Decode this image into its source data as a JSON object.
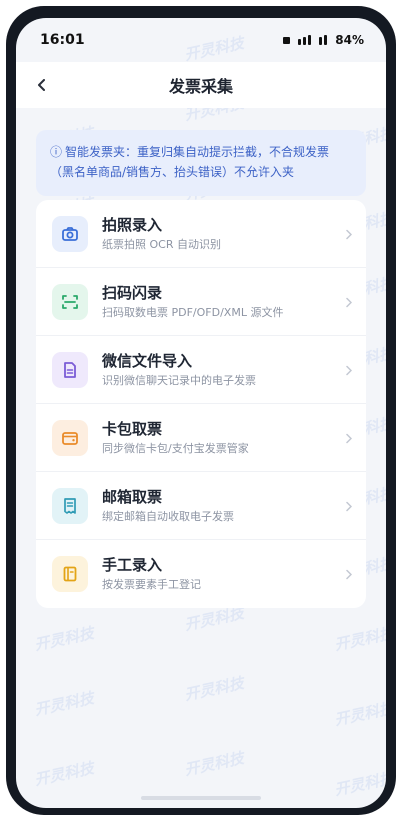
{
  "status_bar": {
    "time": "16:01",
    "battery": "84%"
  },
  "nav": {
    "title": "发票采集",
    "back_icon": "chevron-left-icon"
  },
  "notice": {
    "icon": "info-icon",
    "icon_glyph": "ⓘ",
    "text": "智能发票夹：重复归集自动提示拦截，不合规发票（黑名单商品/销售方、抬头错误）不允许入夹"
  },
  "watermark": {
    "text": "开灵科技"
  },
  "methods": [
    {
      "id": "photo",
      "icon": "camera-icon",
      "title": "拍照录入",
      "subtitle": "纸票拍照 OCR 自动识别",
      "color": "#3a6fd8",
      "bg": "#e7eefc"
    },
    {
      "id": "scan",
      "icon": "scan-icon",
      "title": "扫码闪录",
      "subtitle": "扫码取数电票 PDF/OFD/XML 源文件",
      "color": "#2aa86a",
      "bg": "#e4f6ec"
    },
    {
      "id": "wechat",
      "icon": "document-icon",
      "title": "微信文件导入",
      "subtitle": "识别微信聊天记录中的电子发票",
      "color": "#7b5cd6",
      "bg": "#efe9fc"
    },
    {
      "id": "cardpack",
      "icon": "wallet-icon",
      "title": "卡包取票",
      "subtitle": "同步微信卡包/支付宝发票管家",
      "color": "#e98b2a",
      "bg": "#fdeee0"
    },
    {
      "id": "mailbox",
      "icon": "receipt-icon",
      "title": "邮箱取票",
      "subtitle": "绑定邮箱自动收取电子发票",
      "color": "#2f9bb5",
      "bg": "#e2f3f7"
    },
    {
      "id": "manual",
      "icon": "edit-icon",
      "title": "手工录入",
      "subtitle": "按发票要素手工登记",
      "color": "#e3a416",
      "bg": "#fdf3dc"
    }
  ],
  "chevron_glyph": "›"
}
